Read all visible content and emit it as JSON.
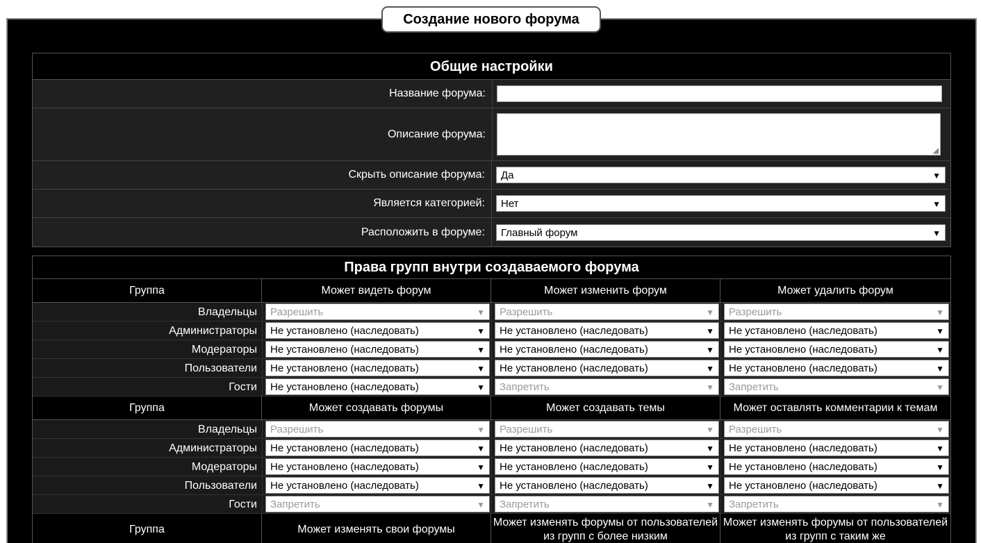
{
  "page_title": "Создание нового форума",
  "general": {
    "heading": "Общие настройки",
    "name_label": "Название форума:",
    "name_value": "",
    "desc_label": "Описание форума:",
    "desc_value": "",
    "hide_desc_label": "Скрыть описание форума:",
    "hide_desc_value": "Да",
    "is_category_label": "Является категорией:",
    "is_category_value": "Нет",
    "parent_label": "Расположить в форуме:",
    "parent_value": "Главный форум"
  },
  "permissions": {
    "heading": "Права групп внутри создаваемого форума",
    "sections": [
      {
        "group_header": "Группа",
        "columns": [
          "Может видеть форум",
          "Может изменить форум",
          "Может удалить форум"
        ],
        "rows": [
          {
            "group": "Владельцы",
            "values": [
              "Разрешить",
              "Разрешить",
              "Разрешить"
            ],
            "disabled": [
              true,
              true,
              true
            ]
          },
          {
            "group": "Администраторы",
            "values": [
              "Не установлено (наследовать)",
              "Не установлено (наследовать)",
              "Не установлено (наследовать)"
            ],
            "disabled": [
              false,
              false,
              false
            ]
          },
          {
            "group": "Модераторы",
            "values": [
              "Не установлено (наследовать)",
              "Не установлено (наследовать)",
              "Не установлено (наследовать)"
            ],
            "disabled": [
              false,
              false,
              false
            ]
          },
          {
            "group": "Пользователи",
            "values": [
              "Не установлено (наследовать)",
              "Не установлено (наследовать)",
              "Не установлено (наследовать)"
            ],
            "disabled": [
              false,
              false,
              false
            ]
          },
          {
            "group": "Гости",
            "values": [
              "Не установлено (наследовать)",
              "Запретить",
              "Запретить"
            ],
            "disabled": [
              false,
              true,
              true
            ]
          }
        ]
      },
      {
        "group_header": "Группа",
        "columns": [
          "Может создавать форумы",
          "Может создавать темы",
          "Может оставлять комментарии к темам"
        ],
        "rows": [
          {
            "group": "Владельцы",
            "values": [
              "Разрешить",
              "Разрешить",
              "Разрешить"
            ],
            "disabled": [
              true,
              true,
              true
            ]
          },
          {
            "group": "Администраторы",
            "values": [
              "Не установлено (наследовать)",
              "Не установлено (наследовать)",
              "Не установлено (наследовать)"
            ],
            "disabled": [
              false,
              false,
              false
            ]
          },
          {
            "group": "Модераторы",
            "values": [
              "Не установлено (наследовать)",
              "Не установлено (наследовать)",
              "Не установлено (наследовать)"
            ],
            "disabled": [
              false,
              false,
              false
            ]
          },
          {
            "group": "Пользователи",
            "values": [
              "Не установлено (наследовать)",
              "Не установлено (наследовать)",
              "Не установлено (наследовать)"
            ],
            "disabled": [
              false,
              false,
              false
            ]
          },
          {
            "group": "Гости",
            "values": [
              "Запретить",
              "Запретить",
              "Запретить"
            ],
            "disabled": [
              true,
              true,
              true
            ]
          }
        ]
      }
    ],
    "third_header": {
      "group_header": "Группа",
      "columns": [
        "Может изменять свои форумы",
        "Может изменять форумы от пользователей из групп с более низким",
        "Может изменять форумы от пользователей из групп с таким же"
      ]
    }
  },
  "icons": {
    "dropdown_arrow": "▼",
    "resize_grip": "◢"
  }
}
